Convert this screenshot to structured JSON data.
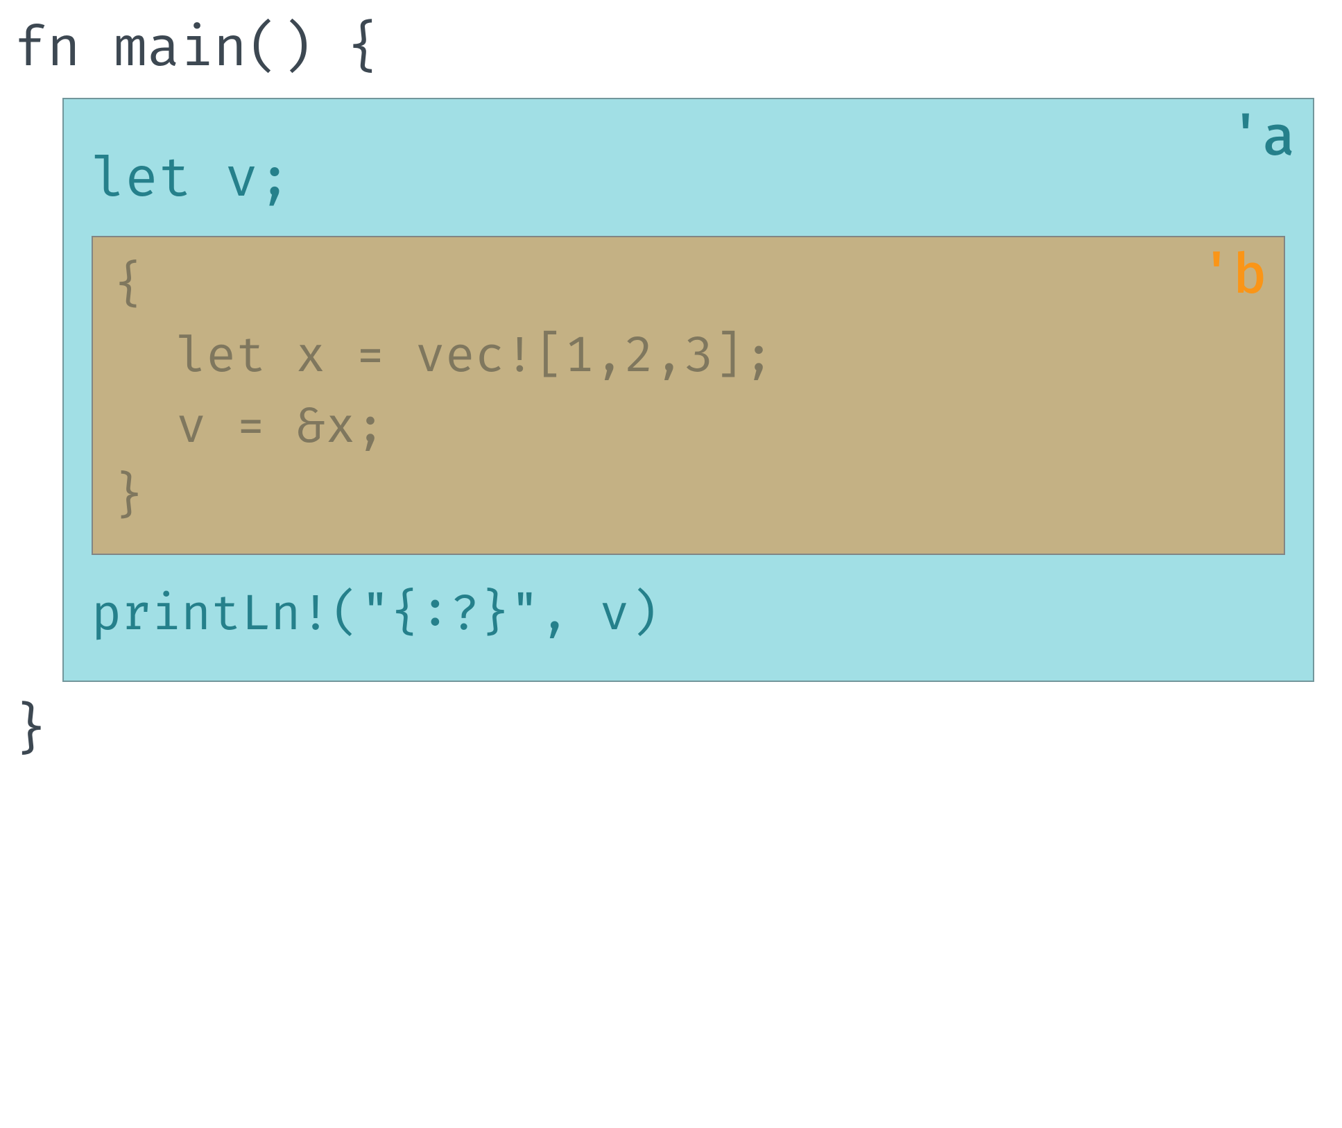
{
  "code": {
    "fn_sig": "fn main() {",
    "close_brace": "}",
    "scope_a": {
      "label": "'a",
      "let_v": "let v;",
      "println": "printLn!(\"{:?}\", v)"
    },
    "scope_b": {
      "label": "'b",
      "open_brace": "{",
      "let_x": "let x = vec![1,2,3];",
      "assign_v": "v = &x;",
      "close_brace": "}"
    }
  },
  "colors": {
    "scope_a_bg": "#9ddee4",
    "scope_b_bg": "#c3ab79",
    "lifetime_a": "#1a7a85",
    "lifetime_b": "#ff8c00",
    "code_text": "#3d4852"
  }
}
